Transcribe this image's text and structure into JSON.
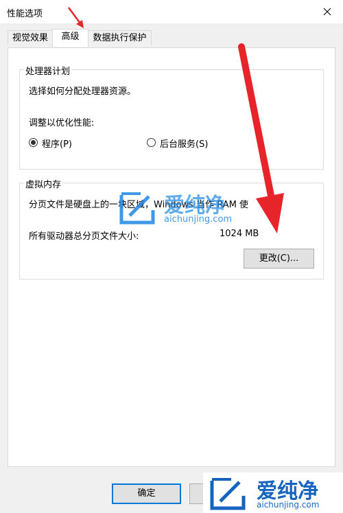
{
  "window": {
    "title": "性能选项"
  },
  "tabs": [
    {
      "label": "视觉效果"
    },
    {
      "label": "高级"
    },
    {
      "label": "数据执行保护"
    }
  ],
  "processor": {
    "group_title": "处理器计划",
    "description": "选择如何分配处理器资源。",
    "adjust_label": "调整以优化性能:",
    "options": [
      {
        "label": "程序(P)",
        "checked": true
      },
      {
        "label": "后台服务(S)",
        "checked": false
      }
    ]
  },
  "virtual_memory": {
    "group_title": "虚拟内存",
    "description": "分页文件是硬盘上的一块区域，Windows 当作 RAM 使",
    "total_label": "所有驱动器总分页文件大小:",
    "total_value": "1024 MB",
    "change_button": "更改(C)..."
  },
  "footer": {
    "ok_button": "确定"
  },
  "watermark": {
    "brand": "爱纯净",
    "url": "aichunjing.com"
  },
  "colors": {
    "annotation_arrow": "#e8242b",
    "watermark_blue": "#1e88e5",
    "default_button_border": "#0078d7"
  }
}
